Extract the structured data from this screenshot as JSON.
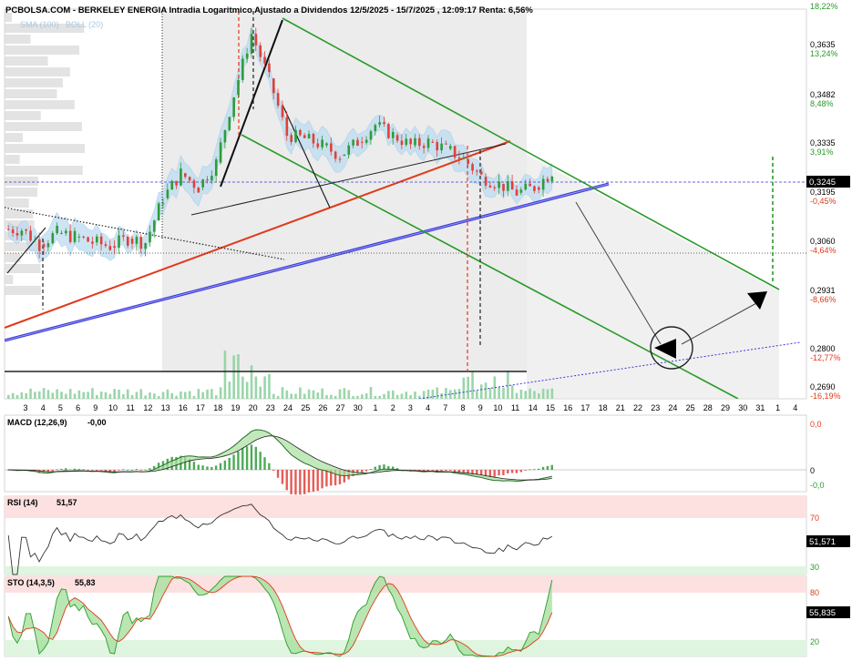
{
  "title": "PCBOLSA.COM - BERKELEY ENERGIA Intradia Logaritmico Ajustado a Dividendos 12/5/2025 - 15/7/2025 , 12:09:17 Renta: 6,56%",
  "colors": {
    "up": "#2e9b3a",
    "down": "#e0403a",
    "green_channel": "#2a9a2a",
    "red_trend": "#e03a1a",
    "blue_trend": "#3a3ad8",
    "boll": "#bcdcf0",
    "price_line": "#3a3ad8",
    "label_bg": "#000000"
  },
  "main_chart": {
    "legend": [
      "SMA (100)",
      "BOLL (20)"
    ],
    "current_price": "0,3245",
    "x_ticks": [
      "3",
      "4",
      "5",
      "6",
      "9",
      "10",
      "11",
      "12",
      "13",
      "16",
      "17",
      "18",
      "19",
      "20",
      "23",
      "24",
      "25",
      "26",
      "27",
      "30",
      "1",
      "2",
      "3",
      "4",
      "7",
      "8",
      "9",
      "10",
      "11",
      "14",
      "15",
      "16",
      "17",
      "18",
      "21",
      "22",
      "23",
      "24",
      "25",
      "28",
      "29",
      "30",
      "31",
      "1",
      "4"
    ],
    "y_axis": [
      {
        "price": "",
        "pct": "18,22%"
      },
      {
        "price": "0,3635",
        "pct": "13,24%"
      },
      {
        "price": "0,3482",
        "pct": "8,48%"
      },
      {
        "price": "0,3335",
        "pct": "3,91%"
      },
      {
        "price": "0,3195",
        "pct": "-0,45%"
      },
      {
        "price": "0,3060",
        "pct": "-4,64%"
      },
      {
        "price": "0,2931",
        "pct": "-8,66%"
      },
      {
        "price": "0,2800",
        "pct": "-12,77%"
      },
      {
        "price": "0,2690",
        "pct": "-16,19%"
      }
    ]
  },
  "macd": {
    "label": "MACD (12,26,9)",
    "value": "-0,00",
    "y_axis": [
      "0,0",
      "0",
      "-0,0"
    ]
  },
  "rsi": {
    "label": "RSI (14)",
    "value": "51,57",
    "current": "51,571",
    "y_axis": [
      "70",
      "30"
    ]
  },
  "sto": {
    "label": "STO (14,3,5)",
    "value": "55,83",
    "current": "55,835",
    "y_axis": [
      "80",
      "20"
    ]
  },
  "chart_data": {
    "type": "line",
    "subtype": "candlestick",
    "title": "BERKELEY ENERGIA Intradia Logaritmico Ajustado a Dividendos 12/5/2025 - 15/7/2025",
    "x_categories": [
      "3",
      "4",
      "5",
      "6",
      "9",
      "10",
      "11",
      "12",
      "13",
      "16",
      "17",
      "18",
      "19",
      "20",
      "23",
      "24",
      "25",
      "26",
      "27",
      "30",
      "1",
      "2",
      "3",
      "4",
      "7",
      "8",
      "9",
      "10",
      "11",
      "14",
      "15"
    ],
    "close_approx": [
      0.3085,
      0.3045,
      0.3075,
      0.3065,
      0.305,
      0.304,
      0.306,
      0.305,
      0.317,
      0.324,
      0.32,
      0.327,
      0.347,
      0.366,
      0.352,
      0.335,
      0.334,
      0.332,
      0.329,
      0.333,
      0.338,
      0.335,
      0.332,
      0.333,
      0.331,
      0.328,
      0.323,
      0.321,
      0.3185,
      0.32,
      0.3245
    ],
    "y_scale": "log",
    "ylim": [
      0.266,
      0.374
    ],
    "last_price": 0.3245
  }
}
